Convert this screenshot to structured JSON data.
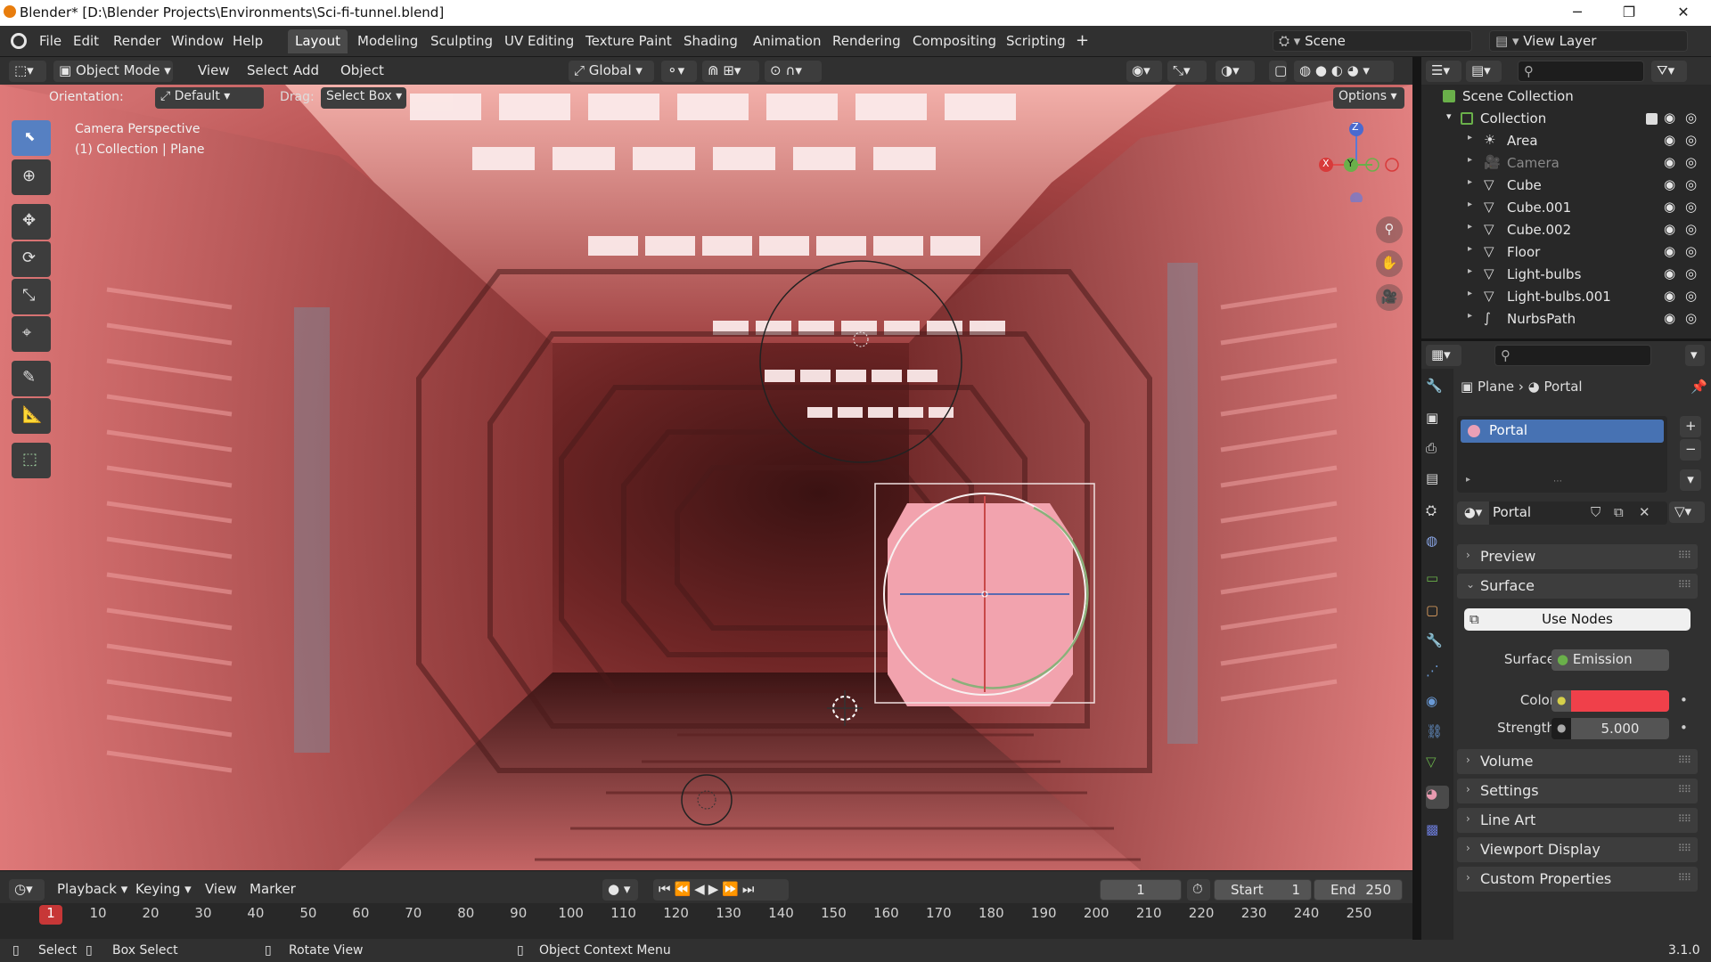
{
  "window": {
    "title": "Blender* [D:\\Blender Projects\\Environments\\Sci-fi-tunnel.blend]",
    "minimize": "─",
    "maximize": "❐",
    "close": "✕"
  },
  "menubar": {
    "items": [
      "File",
      "Edit",
      "Render",
      "Window",
      "Help"
    ]
  },
  "workspaces": {
    "tabs": [
      "Layout",
      "Modeling",
      "Sculpting",
      "UV Editing",
      "Texture Paint",
      "Shading",
      "Animation",
      "Rendering",
      "Compositing",
      "Scripting"
    ],
    "active": "Layout",
    "add": "+"
  },
  "scene": {
    "label": "Scene",
    "view_layer": "View Layer"
  },
  "header3d": {
    "mode": "Object Mode",
    "menus": [
      "View",
      "Select",
      "Add",
      "Object"
    ],
    "transform_orientation": "Global"
  },
  "tool_settings": {
    "orientation_label": "Orientation:",
    "orientation_value": "Default",
    "drag_label": "Drag:",
    "drag_value": "Select Box",
    "options": "Options"
  },
  "viewport": {
    "perspective": "Camera Perspective",
    "context": "(1) Collection | Plane",
    "gizmo": {
      "z": "Z",
      "y": "Y",
      "x": "X"
    }
  },
  "outliner": {
    "scene_collection": "Scene Collection",
    "collection": "Collection",
    "items": [
      {
        "name": "Area",
        "type": "light"
      },
      {
        "name": "Camera",
        "type": "camera"
      },
      {
        "name": "Cube",
        "type": "mesh"
      },
      {
        "name": "Cube.001",
        "type": "mesh"
      },
      {
        "name": "Cube.002",
        "type": "mesh"
      },
      {
        "name": "Floor",
        "type": "mesh"
      },
      {
        "name": "Light-bulbs",
        "type": "mesh"
      },
      {
        "name": "Light-bulbs.001",
        "type": "mesh"
      },
      {
        "name": "NurbsPath",
        "type": "curve"
      }
    ]
  },
  "properties": {
    "breadcrumb_object": "Plane",
    "breadcrumb_material": "Portal",
    "material_slot": "Portal",
    "material_name": "Portal",
    "panels": {
      "preview": "Preview",
      "surface": "Surface",
      "volume": "Volume",
      "settings": "Settings",
      "line_art": "Line Art",
      "viewport_display": "Viewport Display",
      "custom_properties": "Custom Properties"
    },
    "use_nodes": "Use Nodes",
    "surface_label": "Surface",
    "surface_value": "Emission",
    "color_label": "Color",
    "color_value": "#f0404a",
    "strength_label": "Strength",
    "strength_value": "5.000"
  },
  "timeline": {
    "menus": [
      "Playback",
      "Keying",
      "View",
      "Marker"
    ],
    "current_frame": "1",
    "start_label": "Start",
    "start_value": "1",
    "end_label": "End",
    "end_value": "250",
    "ticks": [
      "1",
      "10",
      "20",
      "30",
      "40",
      "50",
      "60",
      "70",
      "80",
      "90",
      "100",
      "110",
      "120",
      "130",
      "140",
      "150",
      "160",
      "170",
      "180",
      "190",
      "200",
      "210",
      "220",
      "230",
      "240",
      "250"
    ]
  },
  "statusbar": {
    "select": "Select",
    "box_select": "Box Select",
    "rotate_view": "Rotate View",
    "context_menu": "Object Context Menu",
    "version": "3.1.0"
  },
  "colors": {
    "accent": "#5680c2",
    "material_dot": "#e9a0b6",
    "portal": "#f2a3ae"
  }
}
